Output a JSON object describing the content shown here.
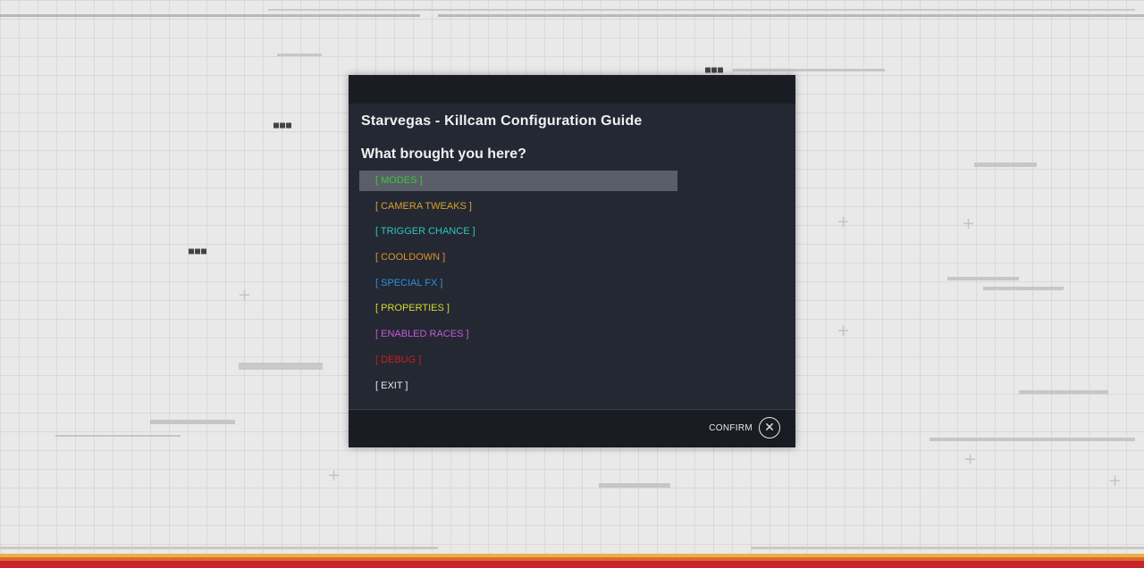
{
  "dialog": {
    "title": "Starvegas - Killcam Configuration Guide",
    "question": "What brought you here?",
    "menu": [
      {
        "label": "[ MODES ]",
        "color": "#3fc63f",
        "selected": true
      },
      {
        "label": "[ CAMERA TWEAKS ]",
        "color": "#d9a12e"
      },
      {
        "label": "[ TRIGGER CHANCE ]",
        "color": "#2ec6b8"
      },
      {
        "label": "[ COOLDOWN ]",
        "color": "#e0912b"
      },
      {
        "label": "[ SPECIAL FX ]",
        "color": "#2e8fe0"
      },
      {
        "label": "[ PROPERTIES ]",
        "color": "#d8d82e"
      },
      {
        "label": "[ ENABLED RACES ]",
        "color": "#c45ad9"
      },
      {
        "label": "[ DEBUG ]",
        "color": "#c62020"
      },
      {
        "label": "[ EXIT ]",
        "color": "#e8e8e8"
      }
    ],
    "footer": {
      "confirm_label": "CONFIRM",
      "confirm_icon": "close-x-icon"
    }
  },
  "background": {
    "base_color": "#e9e9e9",
    "bottom_bar_colors": [
      "#e8b24a",
      "#e0692e",
      "#c8242a"
    ]
  }
}
